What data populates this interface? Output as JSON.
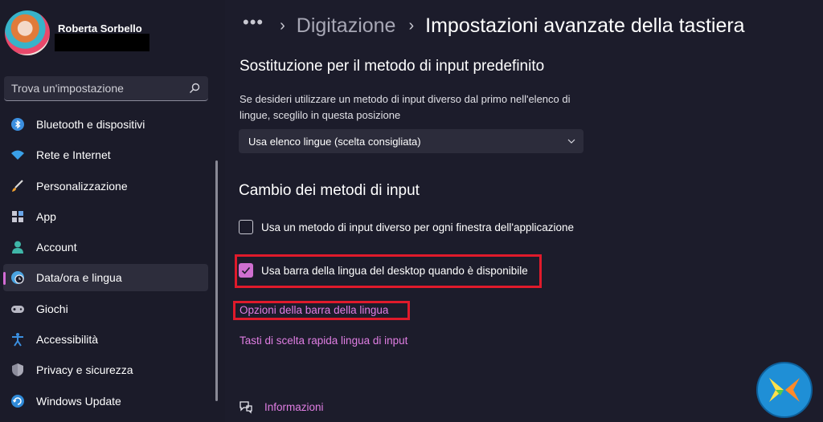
{
  "user": {
    "name": "Roberta Sorbello"
  },
  "search": {
    "placeholder": "Trova un'impostazione"
  },
  "sidebar": {
    "items": [
      {
        "label": "Bluetooth e dispositivi",
        "icon": "bluetooth-icon"
      },
      {
        "label": "Rete e Internet",
        "icon": "wifi-icon"
      },
      {
        "label": "Personalizzazione",
        "icon": "brush-icon"
      },
      {
        "label": "App",
        "icon": "apps-icon"
      },
      {
        "label": "Account",
        "icon": "person-icon"
      },
      {
        "label": "Data/ora e lingua",
        "icon": "globe-clock-icon",
        "active": true
      },
      {
        "label": "Giochi",
        "icon": "gamepad-icon"
      },
      {
        "label": "Accessibilità",
        "icon": "accessibility-icon"
      },
      {
        "label": "Privacy e sicurezza",
        "icon": "shield-icon"
      },
      {
        "label": "Windows Update",
        "icon": "update-icon"
      }
    ]
  },
  "breadcrumb": {
    "more": "•••",
    "parent": "Digitazione",
    "current": "Impostazioni avanzate della tastiera"
  },
  "override": {
    "title": "Sostituzione per il metodo di input predefinito",
    "description": "Se desideri utilizzare un metodo di input diverso dal primo nell'elenco di lingue, sceglilo in questa posizione",
    "dropdown_value": "Usa elenco lingue (scelta consigliata)"
  },
  "switching": {
    "title": "Cambio dei metodi di input",
    "option1": {
      "label": "Usa un metodo di input diverso per ogni finestra dell'applicazione",
      "checked": false
    },
    "option2": {
      "label": "Usa barra della lingua del desktop quando è disponibile",
      "checked": true
    },
    "link_language_bar": "Opzioni della barra della lingua",
    "link_hotkeys": "Tasti di scelta rapida lingua di input"
  },
  "footer": {
    "info_label": "Informazioni"
  },
  "colors": {
    "accent": "#cf6fd0",
    "link": "#e07ee3",
    "highlight": "#e01a2b",
    "background": "#1c1c2b"
  }
}
